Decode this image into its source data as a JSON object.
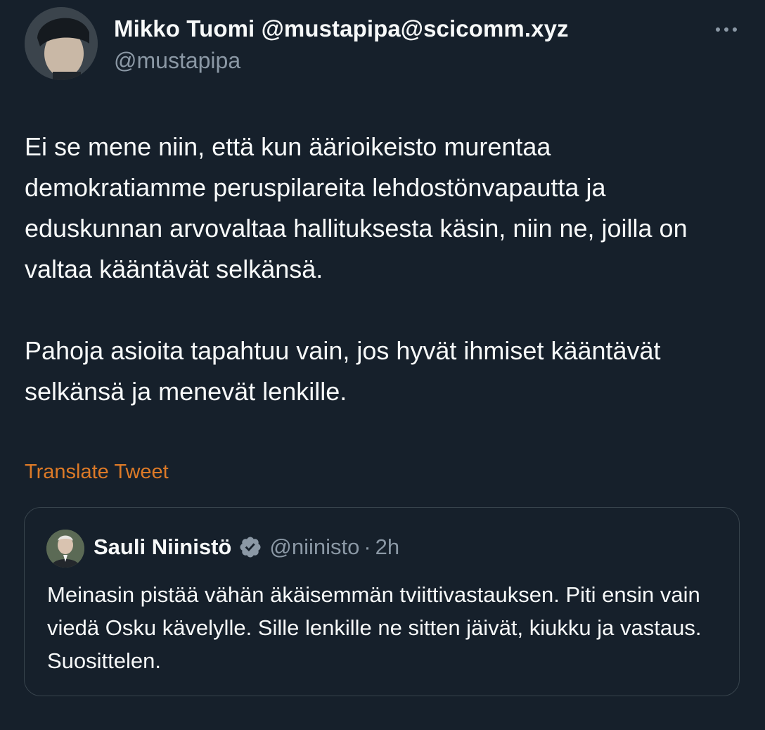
{
  "author": {
    "name": "Mikko Tuomi @mustapipa@scicomm.xyz",
    "handle": "@mustapipa"
  },
  "tweet": {
    "paragraphs": [
      "Ei se mene niin, että kun äärioikeisto murentaa demokratiamme peruspilareita lehdostönvapautta ja eduskunnan arvovaltaa hallituksesta käsin, niin ne, joilla on valtaa kääntävät selkänsä.",
      "Pahoja asioita tapahtuu vain, jos hyvät ihmiset kääntävät selkänsä ja menevät lenkille."
    ],
    "translate_label": "Translate Tweet"
  },
  "quoted": {
    "name": "Sauli Niinistö",
    "handle": "@niinisto",
    "separator": "·",
    "time": "2h",
    "text": "Meinasin pistää vähän äkäisemmän tviittivastauksen. Piti ensin vain viedä Osku kävelylle. Sille lenkille ne sitten jäivät, kiukku ja vastaus. Suosittelen."
  },
  "icons": {
    "more": "more-dots-icon",
    "verified": "verified-badge-icon"
  },
  "colors": {
    "background": "#16202b",
    "text": "#f7f9f9",
    "secondary": "#8b98a5",
    "link": "#dd7a27",
    "border": "#38444d"
  }
}
